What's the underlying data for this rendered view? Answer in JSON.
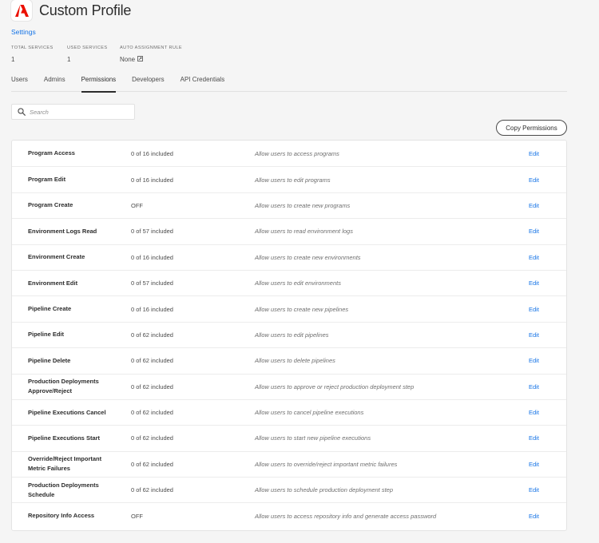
{
  "header": {
    "title": "Custom Profile",
    "logo_icon": "adobe-logo",
    "accent": "#eb1000"
  },
  "settings_link": "Settings",
  "stats": [
    {
      "label": "TOTAL SERVICES",
      "value": "1"
    },
    {
      "label": "USED SERVICES",
      "value": "1"
    },
    {
      "label": "AUTO ASSIGNMENT RULE",
      "value": "None"
    }
  ],
  "tabs": [
    {
      "label": "Users",
      "active": false
    },
    {
      "label": "Admins",
      "active": false
    },
    {
      "label": "Permissions",
      "active": true
    },
    {
      "label": "Developers",
      "active": false
    },
    {
      "label": "API Credentials",
      "active": false
    }
  ],
  "search": {
    "placeholder": "Search",
    "value": ""
  },
  "copy_button": "Copy Permissions",
  "link_color": "#1473e6",
  "permissions": [
    {
      "name": "Program Access",
      "status": "0 of 16 included",
      "description": "Allow users to access programs",
      "action": "Edit"
    },
    {
      "name": "Program Edit",
      "status": "0 of 16 included",
      "description": "Allow users to edit programs",
      "action": "Edit"
    },
    {
      "name": "Program Create",
      "status": "OFF",
      "description": "Allow users to create new programs",
      "action": "Edit"
    },
    {
      "name": "Environment Logs Read",
      "status": "0 of 57 included",
      "description": "Allow users to read environment logs",
      "action": "Edit"
    },
    {
      "name": "Environment Create",
      "status": "0 of 16 included",
      "description": "Allow users to create new environments",
      "action": "Edit"
    },
    {
      "name": "Environment Edit",
      "status": "0 of 57 included",
      "description": "Allow users to edit environments",
      "action": "Edit"
    },
    {
      "name": "Pipeline Create",
      "status": "0 of 16 included",
      "description": "Allow users to create new pipelines",
      "action": "Edit"
    },
    {
      "name": "Pipeline Edit",
      "status": "0 of 62 included",
      "description": "Allow users to edit pipelines",
      "action": "Edit"
    },
    {
      "name": "Pipeline Delete",
      "status": "0 of 62 included",
      "description": "Allow users to delete pipelines",
      "action": "Edit"
    },
    {
      "name": "Production Deployments Approve/Reject",
      "status": "0 of 62 included",
      "description": "Allow users to approve or reject production deployment step",
      "action": "Edit"
    },
    {
      "name": "Pipeline Executions Cancel",
      "status": "0 of 62 included",
      "description": "Allow users to cancel pipeline executions",
      "action": "Edit"
    },
    {
      "name": "Pipeline Executions Start",
      "status": "0 of 62 included",
      "description": "Allow users to start new pipeline executions",
      "action": "Edit"
    },
    {
      "name": "Override/Reject Important Metric Failures",
      "status": "0 of 62 included",
      "description": "Allow users to override/reject important metric failures",
      "action": "Edit"
    },
    {
      "name": "Production Deployments Schedule",
      "status": "0 of 62 included",
      "description": "Allow users to schedule production deployment step",
      "action": "Edit"
    },
    {
      "name": "Repository Info Access",
      "status": "OFF",
      "description": "Allow users to access repository info and generate access password",
      "action": "Edit"
    }
  ]
}
